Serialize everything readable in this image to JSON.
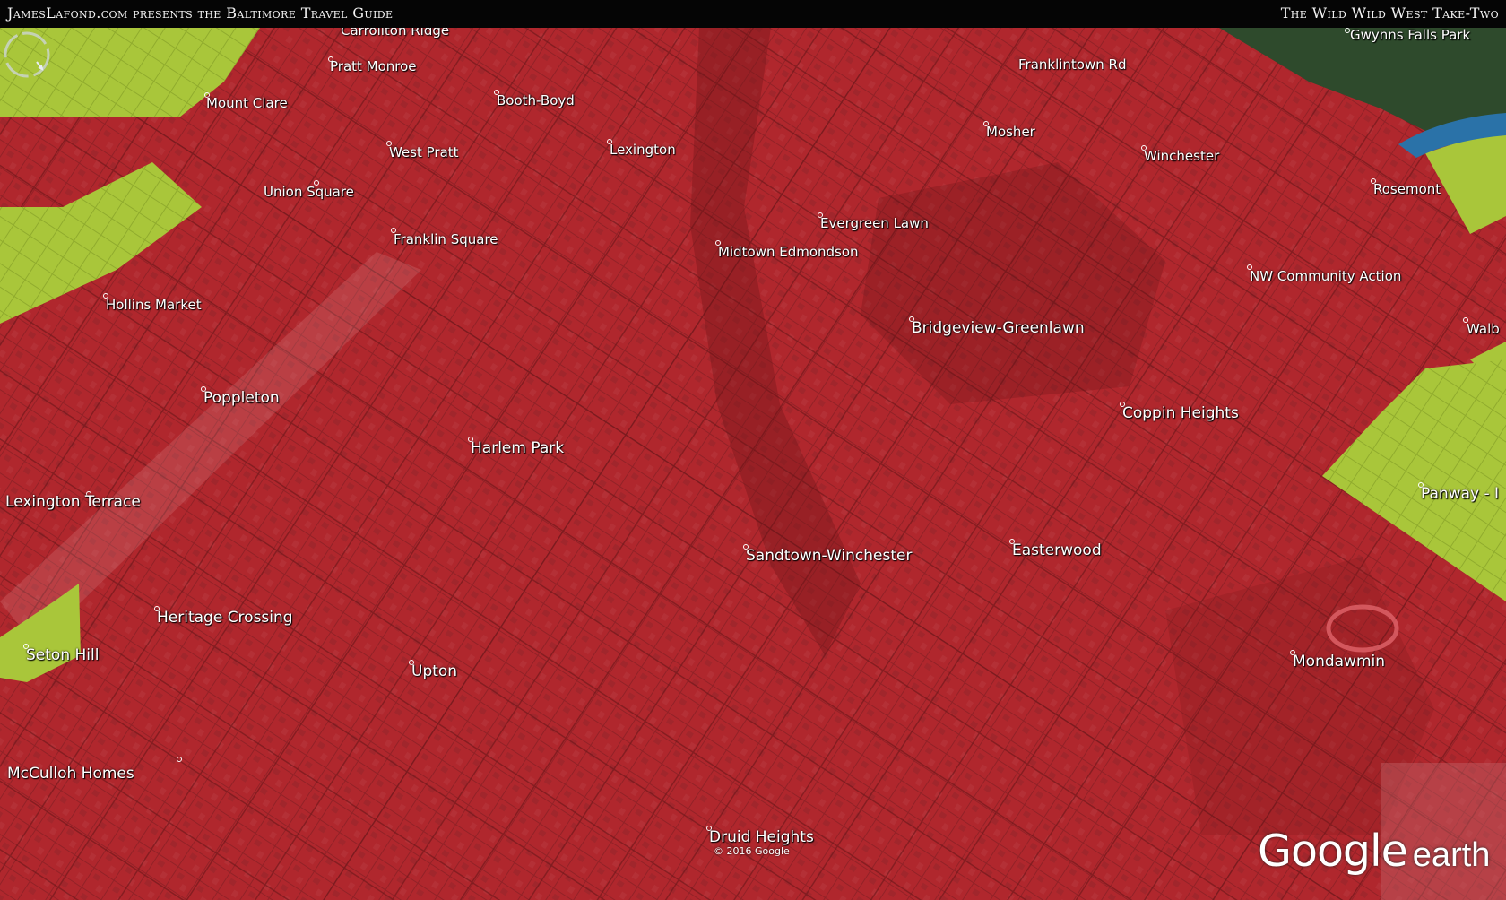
{
  "header": {
    "left_title": "JamesLafond.com presents the Baltimore Travel Guide",
    "right_title": "The Wild Wild West Take-Two"
  },
  "map": {
    "overlay_colors": {
      "danger": "#b3262c",
      "safe": "#a9c63a",
      "water": "#2a72a8"
    },
    "neighborhoods": [
      "Carrollton Ridge",
      "Pratt Monroe",
      "Mount Clare",
      "Booth-Boyd",
      "West Pratt",
      "Lexington",
      "Union Square",
      "Franklin Square",
      "Franklintown Rd",
      "Gwynns Falls Park",
      "Mosher",
      "Winchester",
      "Rosemont",
      "Evergreen Lawn",
      "Midtown Edmondson",
      "NW Community Action",
      "Walb",
      "Bridgeview-Greenlawn",
      "Hollins Market",
      "Poppleton",
      "Harlem Park",
      "Coppin Heights",
      "Lexington Terrace",
      "Panway - I",
      "Sandtown-Winchester",
      "Easterwood",
      "Heritage Crossing",
      "Seton Hill",
      "Upton",
      "Mondawmin",
      "McCulloh Homes",
      "Druid Heights"
    ],
    "copyright": "© 2016 Google",
    "logo": {
      "primary": "Google",
      "secondary": "earth"
    }
  }
}
